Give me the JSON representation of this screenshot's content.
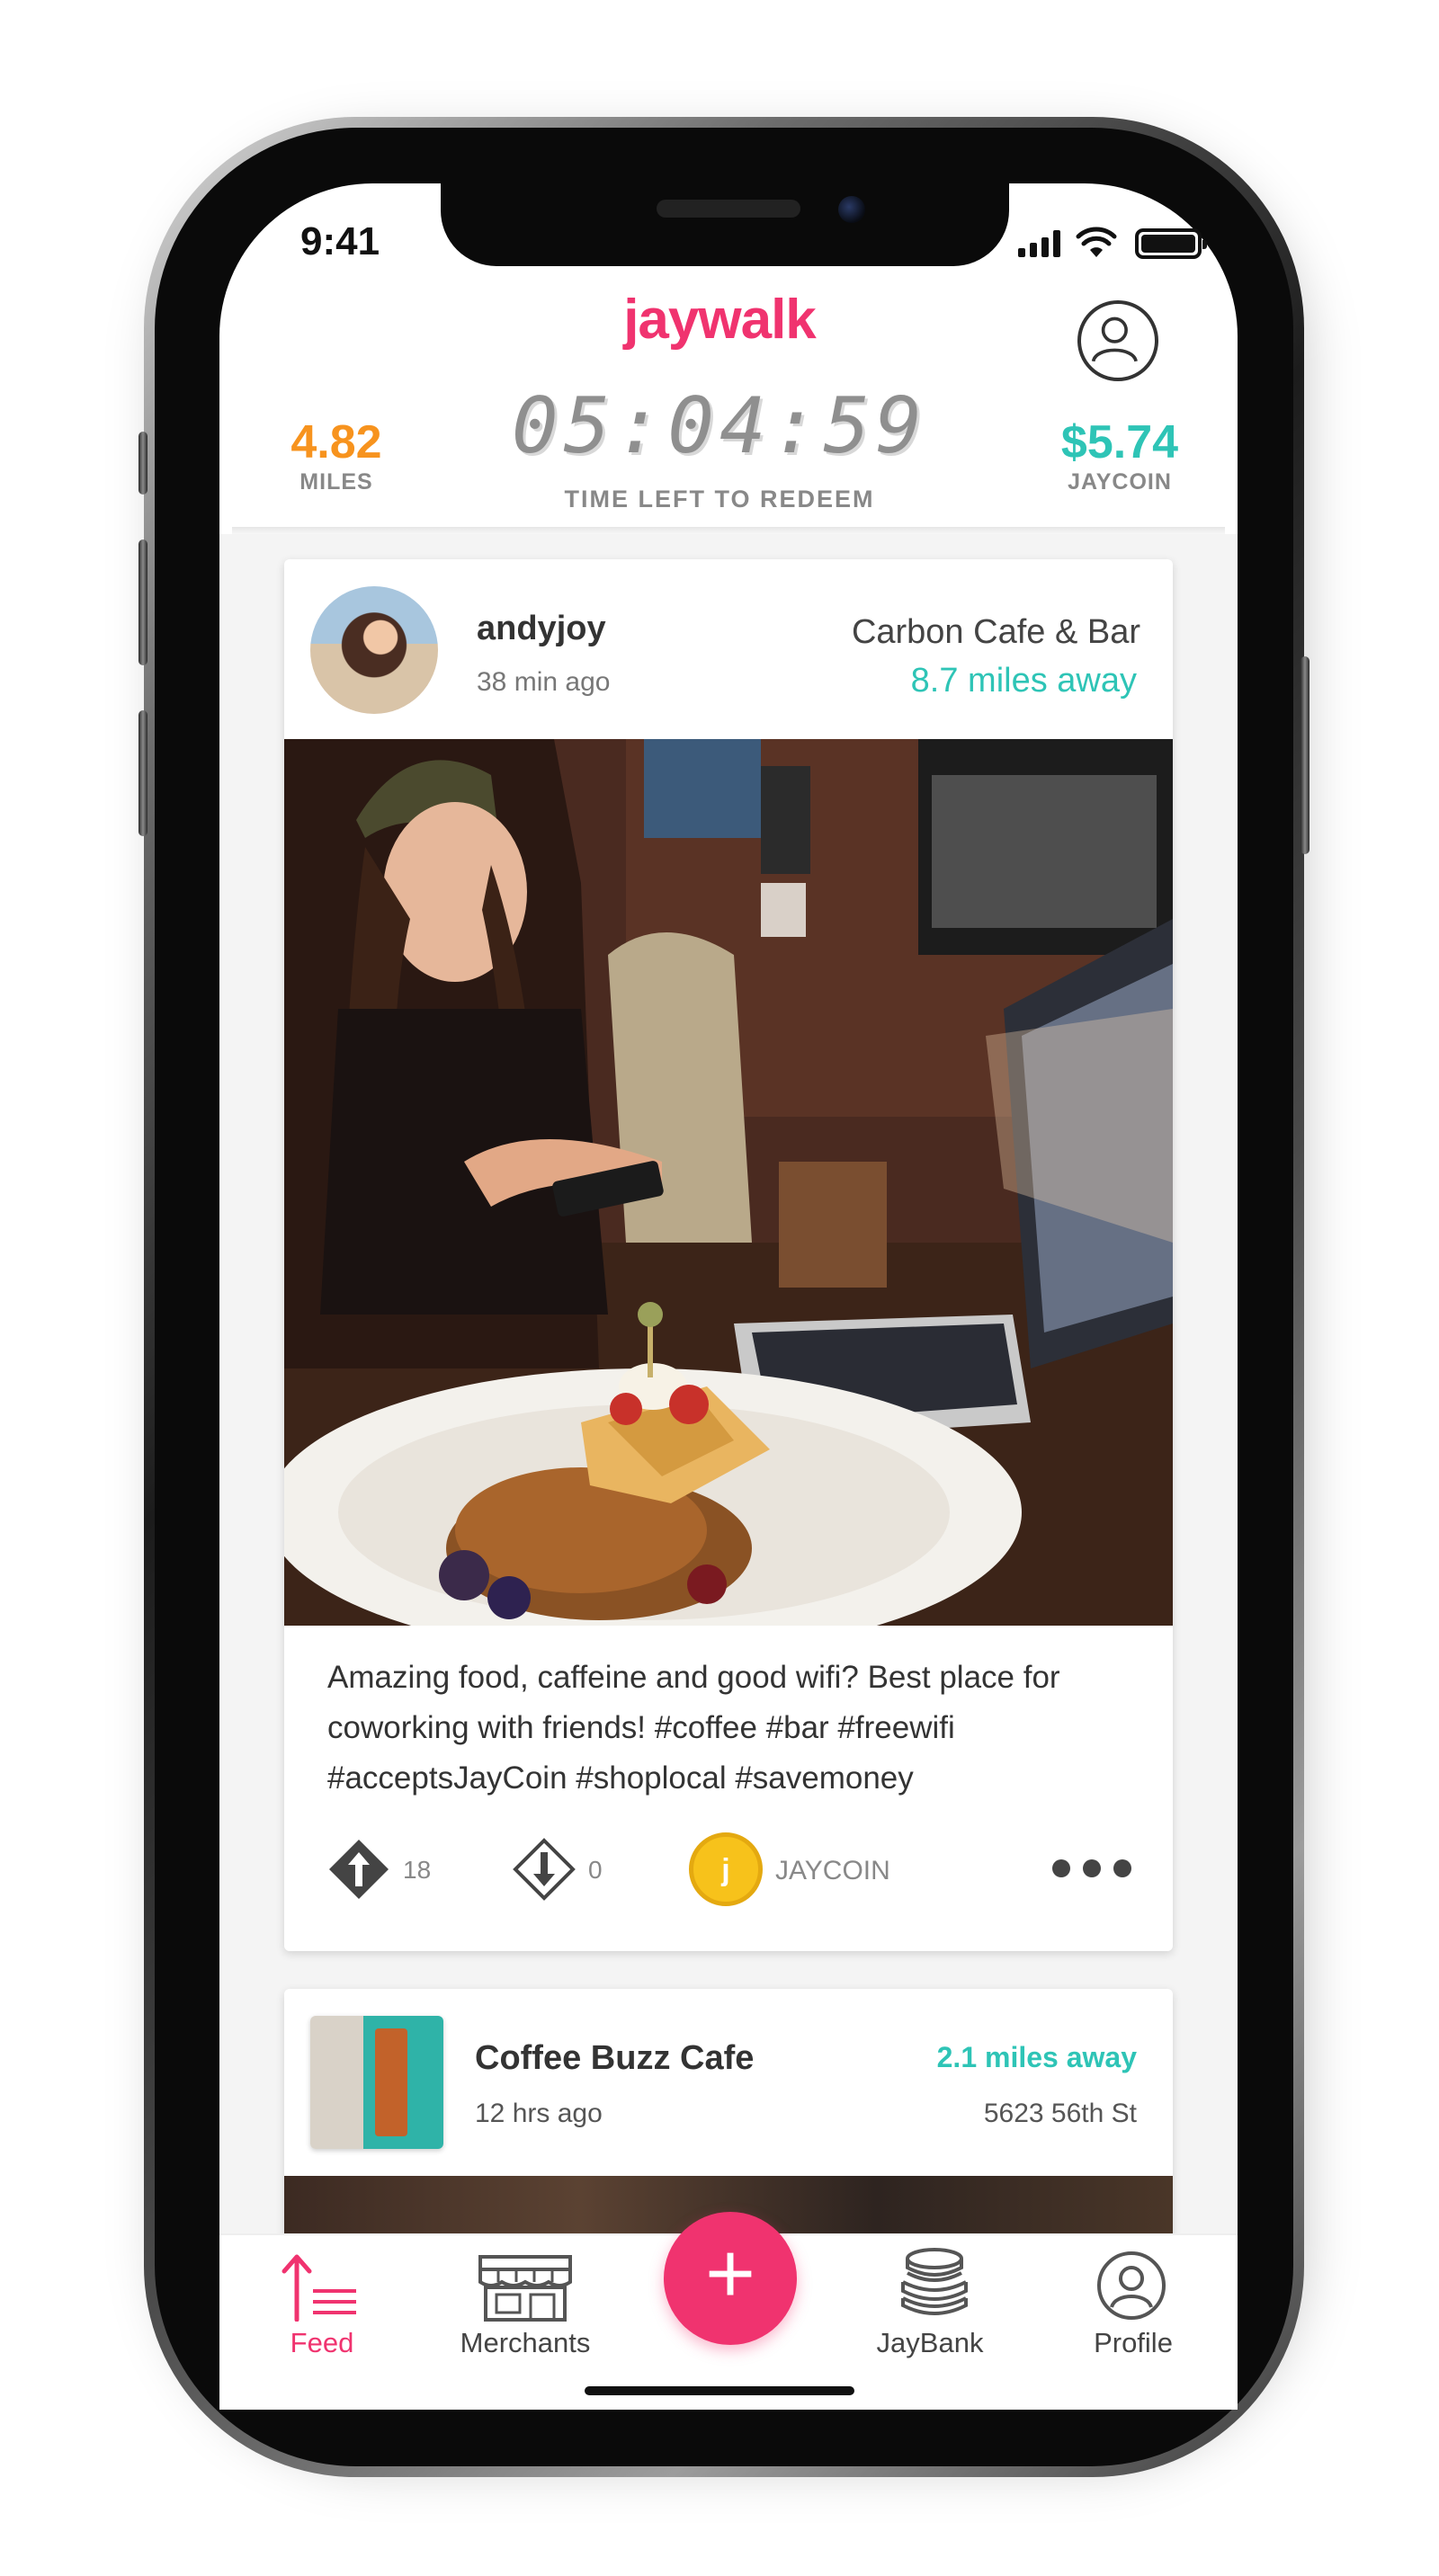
{
  "status_bar": {
    "time": "9:41"
  },
  "header": {
    "logo": "jaywalk",
    "miles_value": "4.82",
    "miles_label": "MILES",
    "timer": "05:04:59",
    "timer_label": "TIME LEFT TO REDEEM",
    "jaycoin_value": "$5.74",
    "jaycoin_label": "JAYCOIN"
  },
  "feed": {
    "posts": [
      {
        "user": "andyjoy",
        "time": "38 min ago",
        "venue": "Carbon Cafe & Bar",
        "distance": "8.7 miles away",
        "caption": "Amazing food, caffeine and good wifi? Best place for coworking with friends!  #coffee #bar #freewifi #acceptsJayCoin #shoplocal #savemoney",
        "upvotes": "18",
        "downvotes": "0",
        "coin_label": "JAYCOIN",
        "coin_letter": "j"
      },
      {
        "venue": "Coffee Buzz Cafe",
        "time": "12 hrs ago",
        "distance": "2.1 miles away",
        "address": "5623 56th St"
      }
    ]
  },
  "tabbar": {
    "feed": "Feed",
    "merchants": "Merchants",
    "add": "+",
    "jaybank": "JayBank",
    "profile": "Profile"
  },
  "colors": {
    "brand": "#f0336f",
    "miles": "#f7931e",
    "jaycoin": "#2ec4b6",
    "coin": "#f7c21b"
  }
}
